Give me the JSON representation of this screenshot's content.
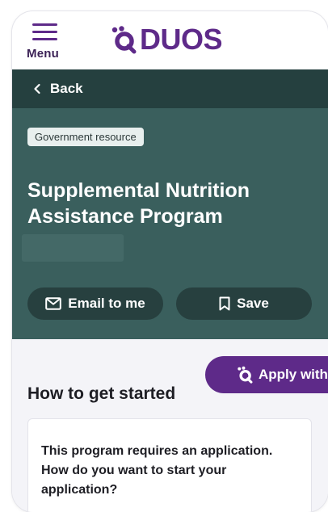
{
  "header": {
    "menu_label": "Menu",
    "logo_text": "DUOS",
    "brand_color": "#5e2a89"
  },
  "nav": {
    "back_label": "Back"
  },
  "hero": {
    "badge": "Government resource",
    "title": "Supplemental Nutrition Assistance Program",
    "email_button": "Email to me",
    "save_button": "Save",
    "background_color": "#3a5f5d"
  },
  "get_started": {
    "heading": "How to get started",
    "apply_button": "Apply with",
    "card_text": "This program requires an application. How do you want to start your application?"
  },
  "icons": {
    "menu": "hamburger-icon",
    "logo": "duos-logo-icon",
    "back": "chevron-left-icon",
    "email": "envelope-icon",
    "save": "bookmark-icon",
    "apply": "duos-logo-icon"
  }
}
